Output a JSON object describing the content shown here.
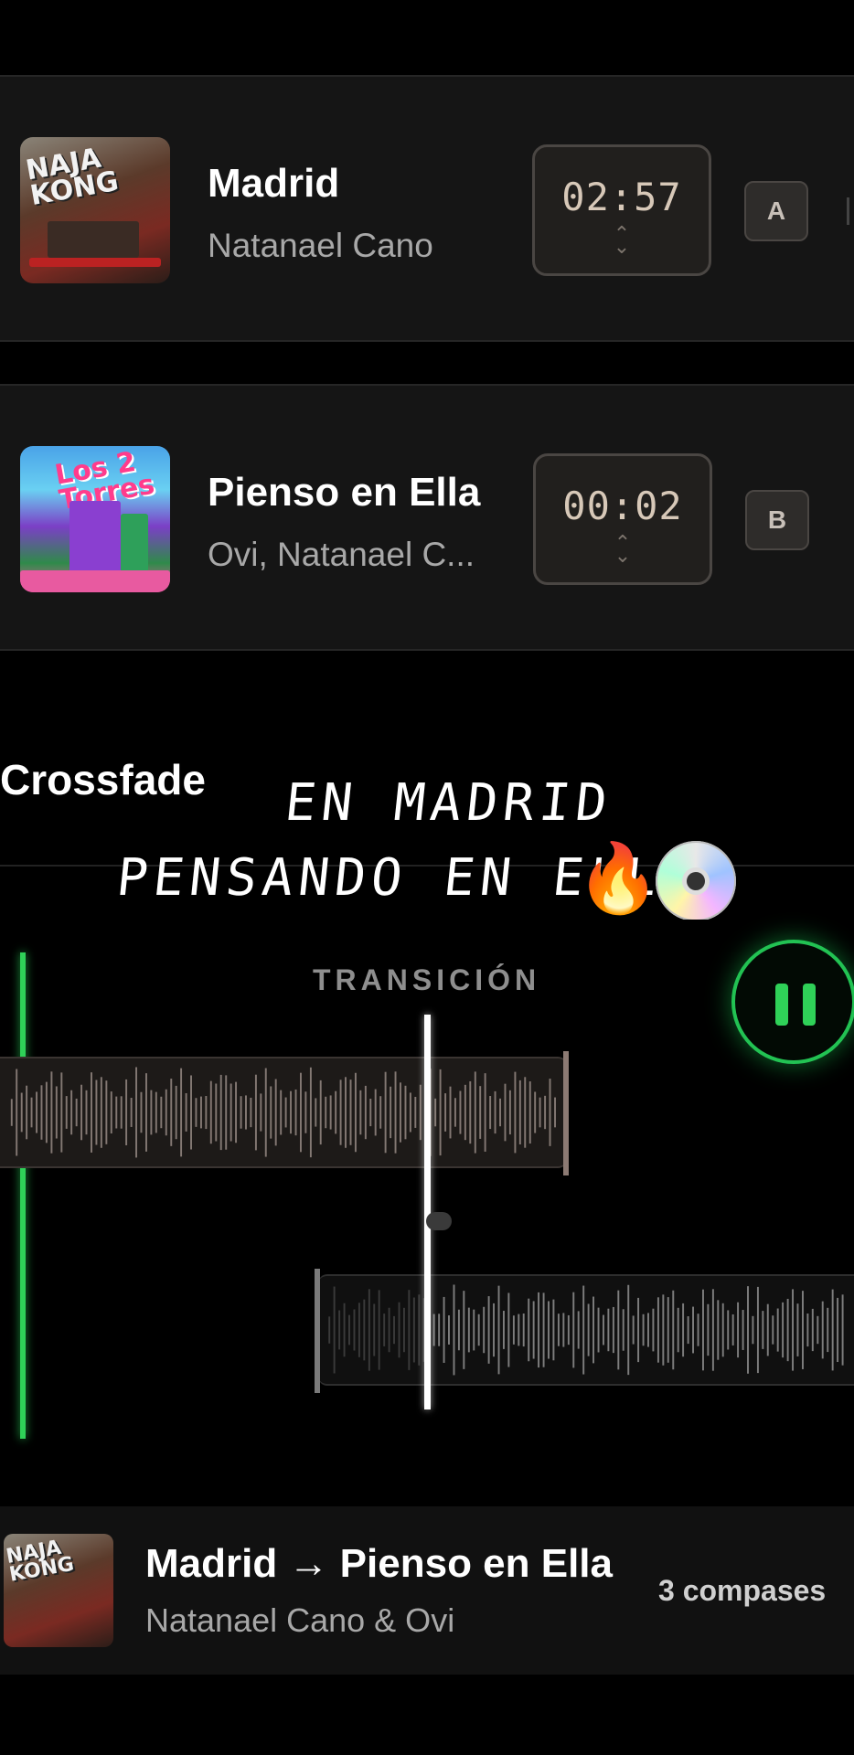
{
  "tracks": [
    {
      "deck": "A",
      "title": "Madrid",
      "artist": "Natanael Cano",
      "time": "02:57",
      "cover_text": "NAJA KONG"
    },
    {
      "deck": "B",
      "title": "Pienso en Ella",
      "artist": "Ovi, Natanael C...",
      "time": "00:02",
      "cover_text": "Los 2 Torres"
    }
  ],
  "crossfade": {
    "heading": "Crossfade",
    "transition_label": "TRANSICIÓN",
    "playback_state": "playing"
  },
  "overlay": {
    "line1": "EN MADRID",
    "line2": "PENSANDO EN ELLA",
    "emoji_fire": "🔥",
    "icon_disc": "disc-icon"
  },
  "now_playing": {
    "title": "Madrid → Pienso en Ella",
    "artist": "Natanael Cano & Ovi",
    "bars": "3 compases",
    "cover_text": "NAJA KONG"
  },
  "colors": {
    "accent_green": "#2fd158",
    "background": "#000000",
    "card": "#151515",
    "time_text": "#d7c8b8"
  }
}
